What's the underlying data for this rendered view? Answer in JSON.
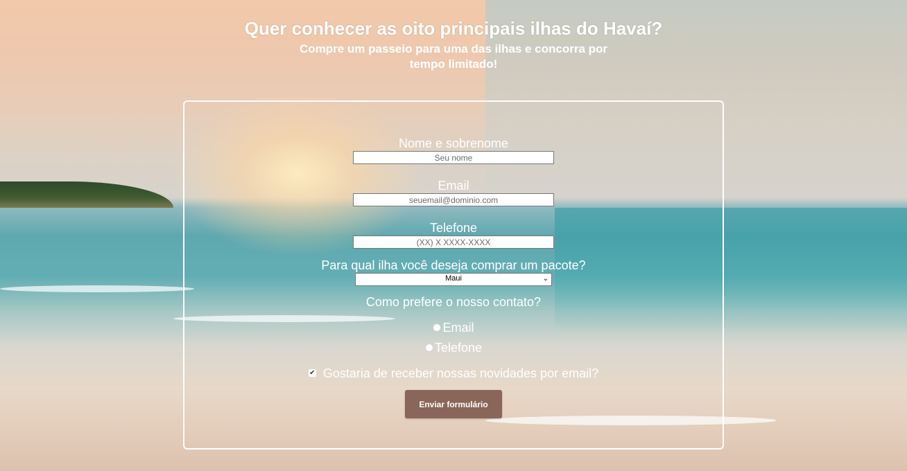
{
  "header": {
    "title": "Quer conhecer as oito principais ilhas do Havaí?",
    "subtitle": "Compre um passeio para uma das ilhas e concorra por tempo limitado!"
  },
  "form": {
    "name_label": "Nome e sobrenome",
    "name_placeholder": "Seu nome",
    "email_label": "Email",
    "email_placeholder": "seuemail@dominio.com",
    "phone_label": "Telefone",
    "phone_placeholder": "(XX) X XXXX-XXXX",
    "island_label": "Para qual ilha você deseja comprar um pacote?",
    "island_selected": "Maui",
    "contact_label": "Como prefere o nosso contato?",
    "contact_options": [
      "Email",
      "Telefone"
    ],
    "newsletter_label": "Gostaria de receber nossas novidades por email?",
    "newsletter_checked": true,
    "submit_label": "Enviar formulário"
  },
  "icons": {
    "select_chevron": "chevron-down-icon",
    "checkbox_mark": "checkmark-icon"
  }
}
